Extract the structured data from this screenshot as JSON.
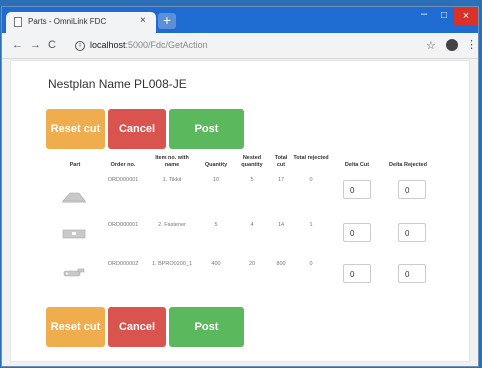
{
  "browser": {
    "tab_title": "Parts - OmniLink FDC",
    "tab_close": "×",
    "newtab": "+",
    "min": "‒",
    "max": "□",
    "close": "×",
    "back": "←",
    "forward": "→",
    "reload": "C",
    "url_host": "localhost",
    "url_path": ":5000/Fdc/GetAction",
    "info": "i",
    "star": "☆",
    "menu": "⋮"
  },
  "page": {
    "heading": "Nestplan Name PL008-JE",
    "buttons": {
      "reset": "Reset cut",
      "cancel": "Cancel",
      "post": "Post"
    },
    "columns": {
      "part": "Part",
      "order": "Order no.",
      "item": "Item no. with name",
      "quantity": "Quantity",
      "nested": "Nested quantity",
      "total_cut": "Total cut",
      "total_rejected": "Total rejected",
      "delta_cut": "Delta Cut",
      "delta_rejected": "Delta Rejected"
    },
    "rows": [
      {
        "order": "ORD000001",
        "item": "1. Tikkit",
        "quantity": "10",
        "nested": "5",
        "total_cut": "17",
        "total_rejected": "0",
        "delta_cut": "0",
        "delta_rejected": "0"
      },
      {
        "order": "ORD000001",
        "item": "2. Fastener",
        "quantity": "5",
        "nested": "4",
        "total_cut": "14",
        "total_rejected": "1",
        "delta_cut": "0",
        "delta_rejected": "0"
      },
      {
        "order": "ORD000002",
        "item": "1. BPRO0200_1",
        "quantity": "400",
        "nested": "20",
        "total_cut": "800",
        "total_rejected": "0",
        "delta_cut": "0",
        "delta_rejected": "0"
      }
    ]
  }
}
